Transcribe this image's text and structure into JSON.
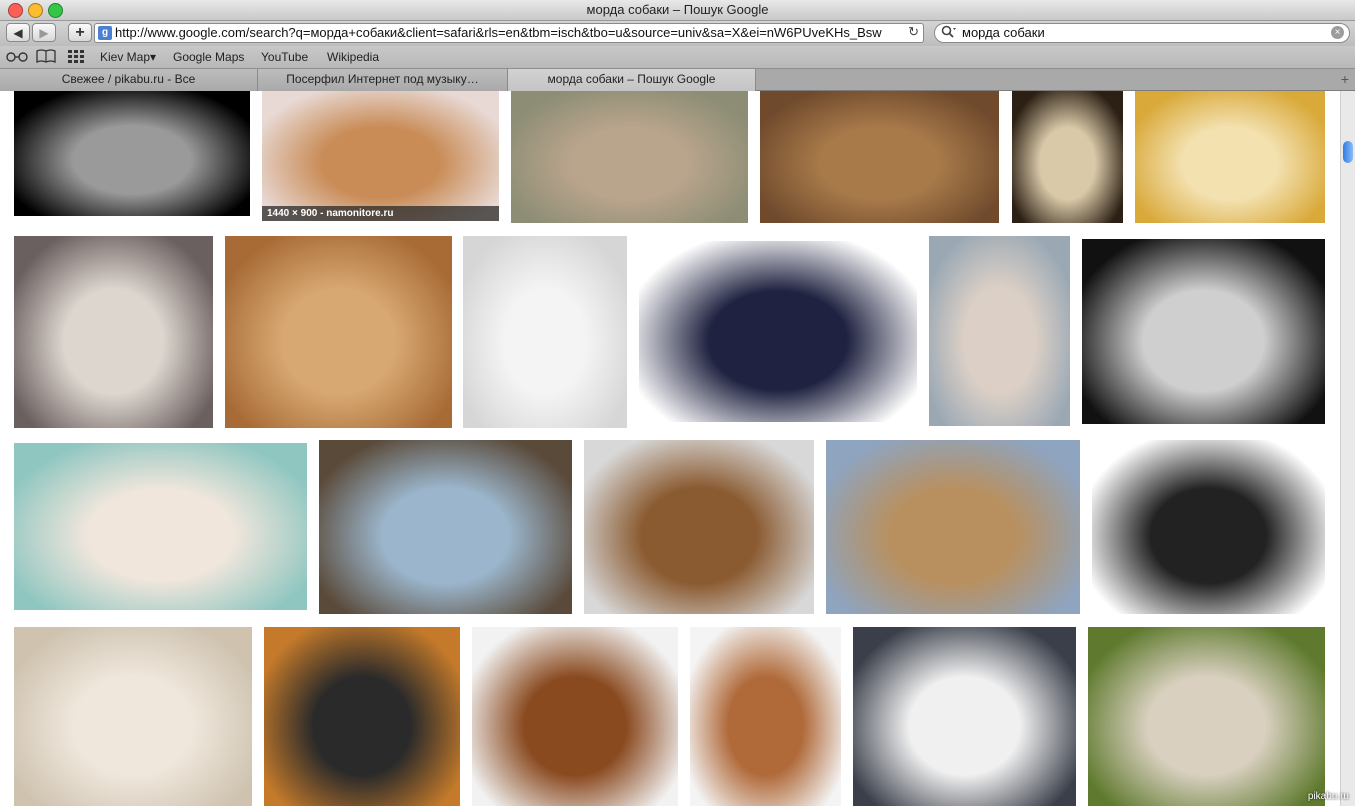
{
  "window": {
    "title": "морда собаки – Пошук Google"
  },
  "traffic_lights": {
    "close": "#fc5f57",
    "minimize": "#fdbc2e",
    "zoom": "#33c748"
  },
  "toolbar": {
    "back": "◀",
    "forward": "▶",
    "add": "+",
    "url": "http://www.google.com/search?q=морда+собаки&client=safari&rls=en&tbm=isch&tbo=u&source=univ&sa=X&ei=nW6PUveKHs_Bsw",
    "favicon": "g",
    "reload": "↻",
    "search_query": "морда собаки",
    "search_icon": "magnifier",
    "clear": "×"
  },
  "bookmarks": [
    "Kiev Map▾",
    "Google Maps",
    "YouTube",
    "Wikipedia"
  ],
  "tabs": [
    {
      "label": "Свежее / pikabu.ru - Все"
    },
    {
      "label": "Посерфил Интернет под музыку…"
    },
    {
      "label": "морда собаки – Пошук Google"
    }
  ],
  "results": {
    "hover_caption": "1440 × 900 - namonitore.ru",
    "watermark": "pikabu.ru",
    "images": [
      {
        "name": "dachshund-black",
        "colors": [
          "#000000",
          "#9a9a9a"
        ]
      },
      {
        "name": "chihuahua-pink",
        "colors": [
          "#e8d9d4",
          "#c98c57"
        ]
      },
      {
        "name": "shaggy-terrier",
        "colors": [
          "#8d8d75",
          "#b9a48c"
        ]
      },
      {
        "name": "brown-dog-porcupine",
        "colors": [
          "#6f4a2c",
          "#a87a4a"
        ]
      },
      {
        "name": "dog-closeup-nose",
        "colors": [
          "#2c2014",
          "#d9c9a8"
        ]
      },
      {
        "name": "vector-dog",
        "colors": [
          "#d9a93a",
          "#f3e1b0"
        ]
      },
      {
        "name": "bulldog-collar",
        "colors": [
          "#6b6060",
          "#ddd6cf"
        ]
      },
      {
        "name": "pug",
        "colors": [
          "#a86b36",
          "#d8a872"
        ]
      },
      {
        "name": "bull-terrier",
        "colors": [
          "#d6d6d6",
          "#f4f4f4"
        ]
      },
      {
        "name": "black-dog-snow",
        "colors": [
          "#ffffff",
          "#1f2240"
        ]
      },
      {
        "name": "putin-portrait",
        "colors": [
          "#9aa8b4",
          "#dcd0c6"
        ]
      },
      {
        "name": "husky-bw",
        "colors": [
          "#111111",
          "#cfcfcf"
        ]
      },
      {
        "name": "yorkie-mug",
        "colors": [
          "#8fc6c0",
          "#f0e6dc"
        ]
      },
      {
        "name": "dog-vs-putin",
        "colors": [
          "#5a4a3a",
          "#9bb6cc"
        ]
      },
      {
        "name": "dogs-porcupines",
        "colors": [
          "#d8d8d8",
          "#8a5a30"
        ]
      },
      {
        "name": "wolf-dog-grass",
        "colors": [
          "#8fa4be",
          "#b89060"
        ]
      },
      {
        "name": "boston-terrier",
        "colors": [
          "#ffffff",
          "#222222"
        ]
      },
      {
        "name": "bulldog-smile",
        "colors": [
          "#cfc3b0",
          "#efe7dc"
        ]
      },
      {
        "name": "hand-painted-dog",
        "colors": [
          "#c47a2a",
          "#2a2a2a"
        ]
      },
      {
        "name": "boxer",
        "colors": [
          "#f2f2f2",
          "#8a4a20"
        ]
      },
      {
        "name": "pharaoh-hound",
        "colors": [
          "#f4f4f4",
          "#b06a3a"
        ]
      },
      {
        "name": "husky-blue-eyes",
        "colors": [
          "#3a3f4a",
          "#f0f0f0"
        ]
      },
      {
        "name": "dog-nose-closeup",
        "colors": [
          "#5f7a2e",
          "#d9d0c0"
        ]
      }
    ]
  }
}
